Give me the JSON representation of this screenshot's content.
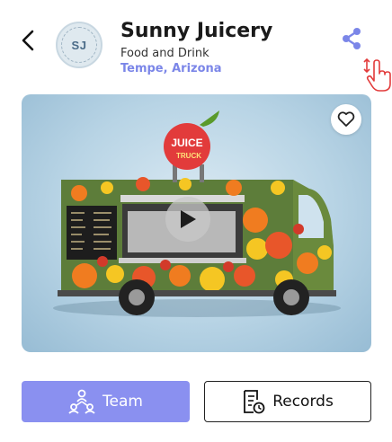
{
  "header": {
    "back_icon": "chevron-left-icon",
    "logo_initials": "SJ",
    "title": "Sunny Juicery",
    "category": "Food and Drink",
    "location": "Tempe, Arizona",
    "share_icon": "share-icon",
    "accent_color": "#7b86e8"
  },
  "media": {
    "type": "video",
    "sign_text_top": "JUICE",
    "sign_text_bottom": "TRUCK",
    "favorite_icon": "heart-outline-icon",
    "play_icon": "play-icon"
  },
  "actions": {
    "team_label": "Team",
    "team_icon": "team-icon",
    "team_color": "#8a90f0",
    "records_label": "Records",
    "records_icon": "records-icon"
  }
}
